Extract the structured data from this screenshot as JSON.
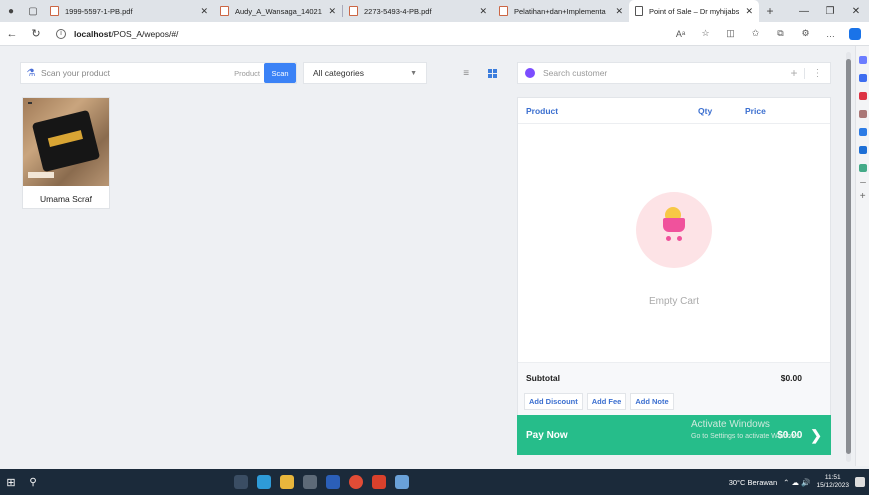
{
  "browser": {
    "tabs": [
      {
        "title": "1999-5597-1-PB.pdf",
        "type": "pdf"
      },
      {
        "title": "Audy_A_Wansaga_1402110",
        "type": "pdf"
      },
      {
        "title": "2273-5493-4-PB.pdf",
        "type": "pdf"
      },
      {
        "title": "Pelatihan+dan+Implementa",
        "type": "pdf"
      },
      {
        "title": "Point of Sale – Dr myhijabsh",
        "type": "page",
        "active": true
      }
    ],
    "new_tab_label": "+",
    "url_host": "localhost",
    "url_path": "/POS_A/wepos/#/"
  },
  "pos": {
    "search_placeholder": "Scan your product",
    "product_label": "Product",
    "scan_label": "Scan",
    "category_selected": "All categories",
    "products": [
      {
        "name": "Umama Scraf"
      }
    ],
    "customer_placeholder": "Search customer",
    "cart": {
      "col_product": "Product",
      "col_qty": "Qty",
      "col_price": "Price",
      "empty_text": "Empty Cart",
      "subtotal_label": "Subtotal",
      "subtotal_value": "$0.00",
      "add_discount": "Add Discount",
      "add_fee": "Add Fee",
      "add_note": "Add Note",
      "pay_now": "Pay Now",
      "pay_total": "$0.00"
    },
    "watermark_line1": "Activate Windows",
    "watermark_line2": "Go to Settings to activate Windows."
  },
  "taskbar": {
    "weather": "30°C  Berawan",
    "time": "11:51",
    "date": "15/12/2023"
  },
  "colors": {
    "accent": "#3b82f6",
    "pay_green": "#26bd8a",
    "link_blue": "#3b6fd0"
  }
}
